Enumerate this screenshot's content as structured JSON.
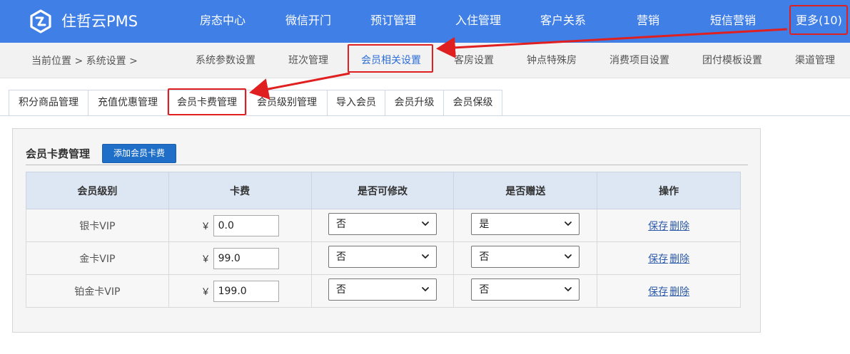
{
  "brand": {
    "name": "住哲云PMS"
  },
  "topnav": {
    "items": [
      {
        "label": "房态中心"
      },
      {
        "label": "微信开门"
      },
      {
        "label": "预订管理"
      },
      {
        "label": "入住管理"
      },
      {
        "label": "客户关系"
      },
      {
        "label": "营销"
      },
      {
        "label": "短信营销"
      }
    ],
    "more_label": "更多(10)"
  },
  "breadcrumb": "当前位置 > 系统设置 >",
  "subnav": {
    "items": [
      {
        "label": "系统参数设置"
      },
      {
        "label": "班次管理"
      },
      {
        "label": "会员相关设置"
      },
      {
        "label": "客房设置"
      },
      {
        "label": "钟点特殊房"
      },
      {
        "label": "消费项目设置"
      },
      {
        "label": "团付模板设置"
      },
      {
        "label": "渠道管理"
      }
    ],
    "active_index": 2
  },
  "tabs": {
    "items": [
      {
        "label": "积分商品管理"
      },
      {
        "label": "充值优惠管理"
      },
      {
        "label": "会员卡费管理"
      },
      {
        "label": "会员级别管理"
      },
      {
        "label": "导入会员"
      },
      {
        "label": "会员升级"
      },
      {
        "label": "会员保级"
      }
    ],
    "active_index": 2
  },
  "panel": {
    "title": "会员卡费管理",
    "add_button": "添加会员卡费",
    "columns": [
      "会员级别",
      "卡费",
      "是否可修改",
      "是否赠送",
      "操作"
    ],
    "currency": "￥",
    "rows": [
      {
        "level": "银卡VIP",
        "fee": "0.0",
        "modifiable": "否",
        "gift": "是",
        "save": "保存",
        "delete": "删除"
      },
      {
        "level": "金卡VIP",
        "fee": "99.0",
        "modifiable": "否",
        "gift": "否",
        "save": "保存",
        "delete": "删除"
      },
      {
        "level": "铂金卡VIP",
        "fee": "199.0",
        "modifiable": "否",
        "gift": "否",
        "save": "保存",
        "delete": "删除"
      }
    ]
  },
  "colors": {
    "topbar": "#3f7fe6",
    "accent_link": "#2d6fd6",
    "add_button": "#1f6fc8",
    "table_header": "#dde6f3",
    "annotation_red": "#e02020"
  }
}
